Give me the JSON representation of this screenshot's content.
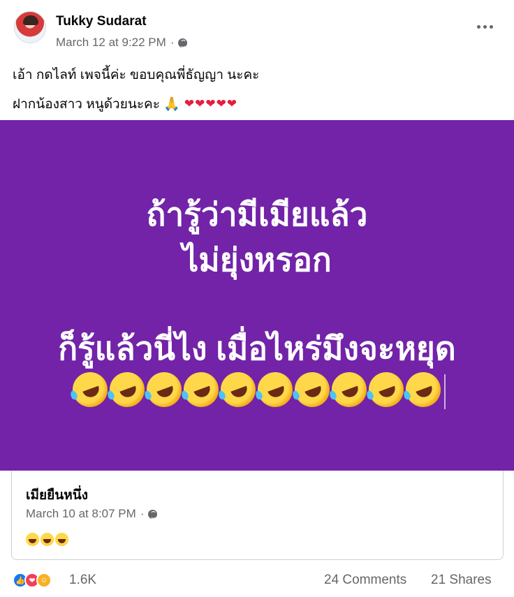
{
  "post": {
    "author": "Tukky Sudarat",
    "timestamp": "March 12 at 9:22 PM",
    "separator": "·",
    "caption_line1": "เอ้า กดไลท์ เพจนี้ค่ะ ขอบคุณพี่ธัญญา นะคะ",
    "caption_line2": "ฝากน้องสาว หนูด้วยนะคะ 🙏",
    "caption_hearts": "❤❤❤❤❤"
  },
  "shared_image": {
    "line1": "ถ้ารู้ว่ามีเมียแล้ว",
    "line2": "ไม่ยุ่งหรอก",
    "line3": "ก็รู้แล้วนี่ไง เมื่อไหร่มึงจะหยุด",
    "emoji_count": 10,
    "background_color": "#7223a8"
  },
  "shared_post": {
    "author": "เมียยืนหนึ่ง",
    "timestamp": "March 10 at 8:07 PM",
    "separator": "·",
    "emoji_count": 3
  },
  "footer": {
    "reaction_count": "1.6K",
    "comments": "24 Comments",
    "shares": "21 Shares",
    "reaction_icons": [
      "like-icon",
      "love-icon",
      "haha-icon"
    ]
  }
}
